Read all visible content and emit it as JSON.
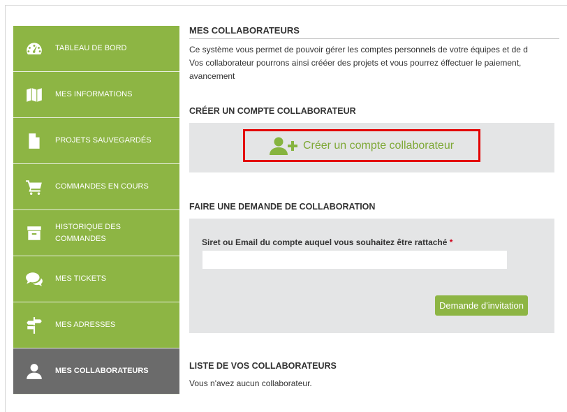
{
  "sidebar": {
    "items": [
      {
        "label": "TABLEAU DE BORD",
        "icon": "dashboard-icon"
      },
      {
        "label": "MES INFORMATIONS",
        "icon": "map-icon"
      },
      {
        "label": "PROJETS SAUVEGARDÉS",
        "icon": "file-icon"
      },
      {
        "label": "COMMANDES EN COURS",
        "icon": "cart-icon"
      },
      {
        "label": "HISTORIQUE DES COMMANDES",
        "icon": "archive-icon"
      },
      {
        "label": "MES TICKETS",
        "icon": "chat-icon"
      },
      {
        "label": "MES ADRESSES",
        "icon": "signpost-icon"
      },
      {
        "label": "MES COLLABORATEURS",
        "icon": "user-icon",
        "active": true
      }
    ]
  },
  "main": {
    "title": "MES COLLABORATEURS",
    "intro_line1": "Ce système vous permet de pouvoir gérer les comptes personnels de votre équipes et de d",
    "intro_line2": "Vos collaborateur pourrons ainsi crééer des projets et vous pourrez éffectuer le paiement, ",
    "intro_line3": "avancement",
    "create_section": {
      "title": "CRÉER UN COMPTE COLLABORATEUR",
      "button_label": "Créer un compte collaborateur"
    },
    "request_section": {
      "title": "FAIRE UNE DEMANDE DE COLLABORATION",
      "field_label": "Siret ou Email du compte auquel vous souhaitez être rattaché",
      "required_mark": "*",
      "field_value": "",
      "button_label": "Demande d'invitation"
    },
    "list_section": {
      "title": "LISTE DE VOS COLLABORATEURS",
      "empty_text": "Vous n'avez aucun collaborateur."
    }
  },
  "colors": {
    "sidebar_green": "#8db544",
    "sidebar_active": "#6b6b6b",
    "accent_green": "#7ea836",
    "highlight_red": "#e30000",
    "panel_grey": "#e4e5e6"
  }
}
